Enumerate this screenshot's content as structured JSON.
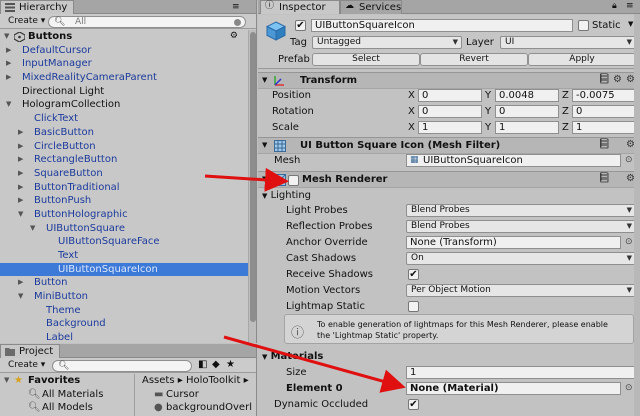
{
  "hierarchy": {
    "tab": "Hierarchy",
    "create": "Create",
    "search_placeholder": "All",
    "scene": "Buttons",
    "rows": [
      {
        "label": "DefaultCursor",
        "blue": true,
        "tri": true,
        "indent": 0
      },
      {
        "label": "InputManager",
        "blue": true,
        "tri": true,
        "indent": 0
      },
      {
        "label": "MixedRealityCameraParent",
        "blue": true,
        "tri": true,
        "indent": 0
      },
      {
        "label": "Directional Light",
        "blue": false,
        "tri": false,
        "indent": 0
      },
      {
        "label": "HologramCollection",
        "blue": false,
        "tri": true,
        "open": true,
        "indent": 0
      },
      {
        "label": "ClickText",
        "blue": true,
        "tri": false,
        "indent": 1
      },
      {
        "label": "BasicButton",
        "blue": true,
        "tri": true,
        "indent": 1
      },
      {
        "label": "CircleButton",
        "blue": true,
        "tri": true,
        "indent": 1
      },
      {
        "label": "RectangleButton",
        "blue": true,
        "tri": true,
        "indent": 1
      },
      {
        "label": "SquareButton",
        "blue": true,
        "tri": true,
        "indent": 1
      },
      {
        "label": "ButtonTraditional",
        "blue": true,
        "tri": true,
        "indent": 1
      },
      {
        "label": "ButtonPush",
        "blue": true,
        "tri": true,
        "indent": 1
      },
      {
        "label": "ButtonHolographic",
        "blue": true,
        "tri": true,
        "open": true,
        "indent": 1
      },
      {
        "label": "UIButtonSquare",
        "blue": true,
        "tri": true,
        "open": true,
        "indent": 2
      },
      {
        "label": "UIButtonSquareFace",
        "blue": true,
        "tri": false,
        "indent": 3
      },
      {
        "label": "Text",
        "blue": true,
        "tri": false,
        "indent": 3
      },
      {
        "label": "UIButtonSquareIcon",
        "blue": true,
        "tri": false,
        "indent": 3,
        "selected": true
      },
      {
        "label": "Button",
        "blue": true,
        "tri": true,
        "indent": 1
      },
      {
        "label": "MiniButton",
        "blue": true,
        "tri": true,
        "open": true,
        "indent": 1
      },
      {
        "label": "Theme",
        "blue": true,
        "tri": false,
        "indent": 2
      },
      {
        "label": "Background",
        "blue": true,
        "tri": false,
        "indent": 2
      },
      {
        "label": "Label",
        "blue": true,
        "tri": false,
        "indent": 2
      }
    ]
  },
  "project": {
    "tab": "Project",
    "create": "Create",
    "favorites": "Favorites",
    "fav_items": [
      "All Materials",
      "All Models"
    ],
    "breadcrumb": [
      "Assets",
      "HoloToolkit"
    ],
    "content_items": [
      "Cursor",
      "backgroundOverl"
    ]
  },
  "inspector": {
    "tab": "Inspector",
    "tab2": "Services",
    "object_name": "UIButtonSquareIcon",
    "static_label": "Static",
    "tag_label": "Tag",
    "tag_value": "Untagged",
    "layer_label": "Layer",
    "layer_value": "UI",
    "prefab_label": "Prefab",
    "prefab_buttons": [
      "Select",
      "Revert",
      "Apply"
    ],
    "transform": {
      "title": "Transform",
      "rows": [
        {
          "label": "Position",
          "x": "0",
          "y": "0.0048",
          "z": "-0.0075"
        },
        {
          "label": "Rotation",
          "x": "0",
          "y": "0",
          "z": "0"
        },
        {
          "label": "Scale",
          "x": "1",
          "y": "1",
          "z": "1"
        }
      ],
      "x": "X",
      "y": "Y",
      "z": "Z"
    },
    "mesh_filter": {
      "title": "UI Button Square Icon (Mesh Filter)",
      "mesh_label": "Mesh",
      "mesh_value": "UIButtonSquareIcon"
    },
    "mesh_renderer": {
      "title": "Mesh Renderer",
      "lighting": "Lighting",
      "rows": [
        {
          "label": "Light Probes",
          "type": "drop",
          "value": "Blend Probes"
        },
        {
          "label": "Reflection Probes",
          "type": "drop",
          "value": "Blend Probes"
        },
        {
          "label": "Anchor Override",
          "type": "obj",
          "value": "None (Transform)"
        },
        {
          "label": "Cast Shadows",
          "type": "drop",
          "value": "On"
        },
        {
          "label": "Receive Shadows",
          "type": "check",
          "value": "✔"
        },
        {
          "label": "Motion Vectors",
          "type": "drop",
          "value": "Per Object Motion"
        },
        {
          "label": "Lightmap Static",
          "type": "check",
          "value": ""
        }
      ],
      "help_line1": "To enable generation of lightmaps for this Mesh Renderer, please enable",
      "help_line2": "the 'Lightmap Static' property.",
      "materials": "Materials",
      "size_label": "Size",
      "size_value": "1",
      "element_label": "Element 0",
      "element_value": "None (Material)",
      "dynamic_label": "Dynamic Occluded",
      "dynamic_value": "✔"
    }
  },
  "colors": {
    "selection": "#3d7ad8",
    "arrow": "#e01010",
    "link_blue": "#1b3a9c"
  }
}
